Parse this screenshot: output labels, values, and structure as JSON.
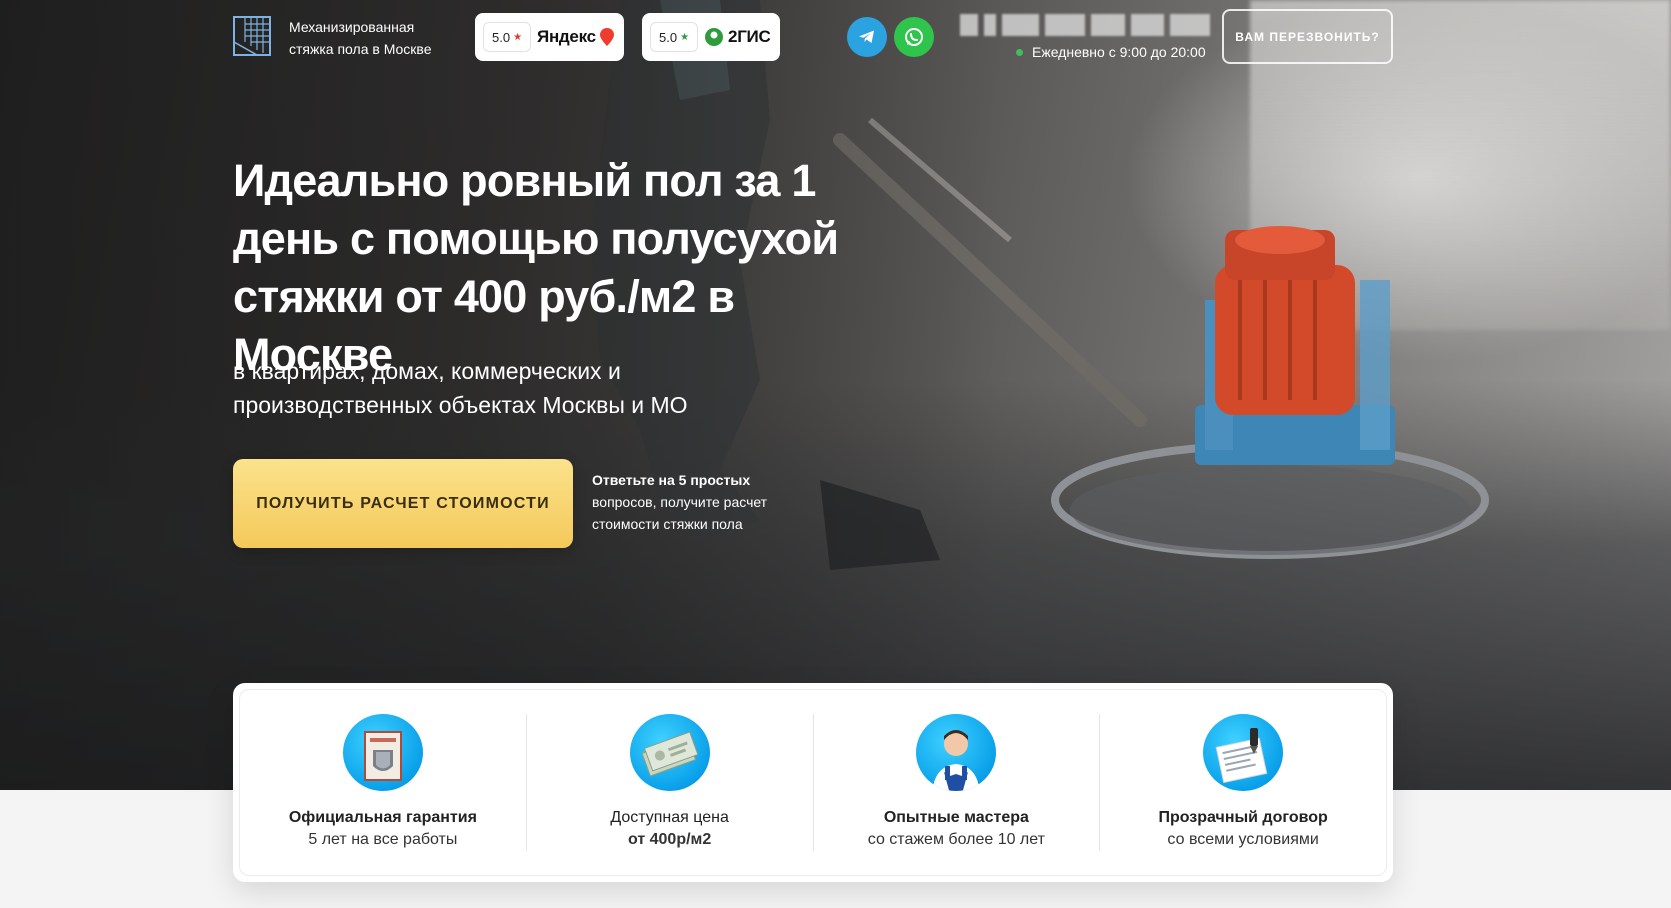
{
  "header": {
    "logo_text": "Механизированная стяжка пола в Москве",
    "ratings": [
      {
        "score": "5.0",
        "brand": "Яндекс",
        "star_color": "#e53935"
      },
      {
        "score": "5.0",
        "brand": "2ГИС",
        "star_color": "#2e9b3c"
      }
    ],
    "social": [
      {
        "name": "telegram",
        "color": "#2aa3e0"
      },
      {
        "name": "whatsapp",
        "color": "#2fc44c"
      }
    ],
    "hours": "Ежедневно с 9:00 до 20:00",
    "callback_label": "ВАМ ПЕРЕЗВОНИТЬ?"
  },
  "hero": {
    "headline_bold": "Идеально ровный пол за 1 день",
    "headline_rest": " с помощью полусухой стяжки от 400 руб./м2 в Москве",
    "subhead": "в квартирах, домах, коммерческих и производственных объектах Москвы и МО",
    "cta_label": "ПОЛУЧИТЬ РАСЧЕТ СТОИМОСТИ",
    "cta_note_bold": "Ответьте на 5 простых",
    "cta_note_rest": " вопросов, получите расчет стоимости стяжки пола"
  },
  "features": [
    {
      "title": "Официальная гарантия",
      "sub": "5 лет на все работы",
      "title_bold": true,
      "icon": "certificate-icon"
    },
    {
      "title": "Доступная цена",
      "sub": "от 400р/м2",
      "title_bold": false,
      "icon": "money-icon"
    },
    {
      "title": "Опытные мастера",
      "sub": "со стажем более 10 лет",
      "title_bold": true,
      "icon": "worker-icon"
    },
    {
      "title": "Прозрачный договор",
      "sub": "со всеми условиями",
      "title_bold": true,
      "icon": "contract-icon"
    }
  ],
  "colors": {
    "cta_gradient_top": "#fbe28c",
    "cta_gradient_bottom": "#f4c95a",
    "icon_blue": "#0aa1ea"
  }
}
